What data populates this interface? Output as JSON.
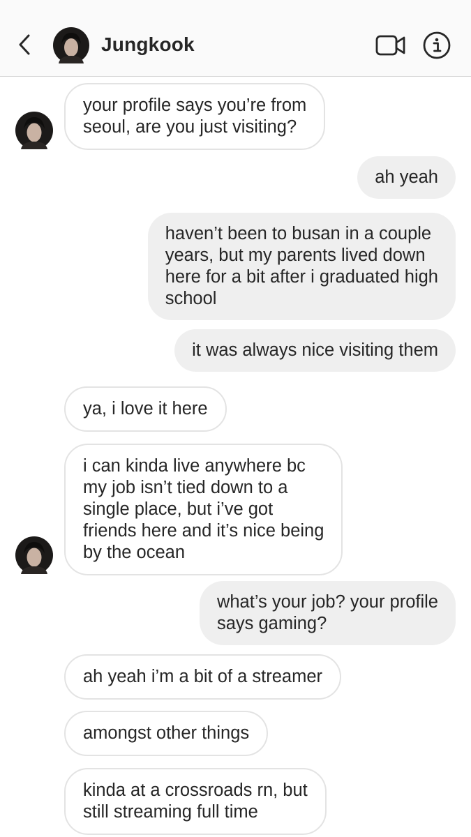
{
  "header": {
    "contact_name": "Jungkook",
    "back_icon": "chevron-left-icon",
    "video_icon": "video-camera-icon",
    "info_icon": "info-circle-icon"
  },
  "colors": {
    "incoming_bubble_bg": "#ffffff",
    "incoming_bubble_border": "#e3e3e3",
    "outgoing_bubble_bg": "#efefef",
    "text": "#262626",
    "header_bg": "#fafafa"
  },
  "messages": [
    {
      "direction": "incoming",
      "text": "your profile says you’re from\nseoul, are you just visiting?"
    },
    {
      "direction": "outgoing",
      "text": "ah yeah"
    },
    {
      "direction": "outgoing",
      "text": "haven’t been to busan in a couple\nyears, but my parents lived down\nhere for a bit after i graduated high\nschool"
    },
    {
      "direction": "outgoing",
      "text": "it was always nice visiting them"
    },
    {
      "direction": "incoming",
      "text": "ya, i love it here"
    },
    {
      "direction": "incoming",
      "text": "i can kinda live anywhere bc\nmy job isn’t tied down to a\nsingle place, but i’ve got\nfriends here and it’s nice being\nby the ocean"
    },
    {
      "direction": "outgoing",
      "text": "what’s your job? your profile\nsays gaming?"
    },
    {
      "direction": "incoming",
      "text": "ah yeah i’m a bit of a streamer"
    },
    {
      "direction": "incoming",
      "text": "amongst other things"
    },
    {
      "direction": "incoming",
      "text": "kinda at a crossroads rn, but\nstill streaming full time"
    }
  ]
}
